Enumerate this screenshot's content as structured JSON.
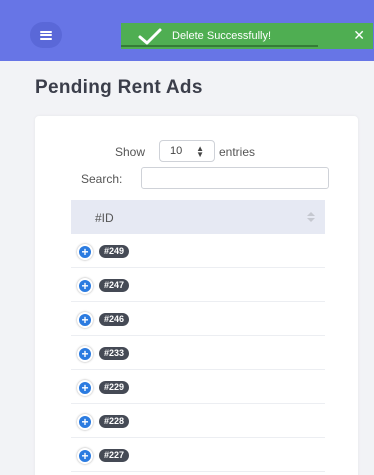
{
  "header": {
    "menu_icon": "hamburger-menu-icon",
    "background_color": "#6775e6"
  },
  "toast": {
    "message": "Delete Successfully!",
    "close_label": "✕",
    "icon": "check-icon",
    "color": "#4fae52",
    "progress_fraction": 0.78
  },
  "page": {
    "title": "Pending Rent Ads"
  },
  "table_controls": {
    "show_label": "Show",
    "entries_value": "10",
    "entries_label": "entries",
    "search_label": "Search:",
    "search_value": ""
  },
  "table": {
    "columns": [
      "#ID"
    ],
    "rows": [
      {
        "id": "#249"
      },
      {
        "id": "#247"
      },
      {
        "id": "#246"
      },
      {
        "id": "#233"
      },
      {
        "id": "#229"
      },
      {
        "id": "#228"
      },
      {
        "id": "#227"
      }
    ]
  }
}
